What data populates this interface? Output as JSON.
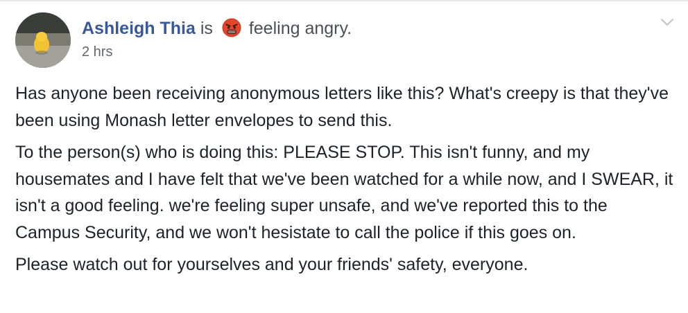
{
  "post": {
    "author_name": "Ashleigh Thia",
    "connector": "is",
    "feeling_icon": "angry-face-emoji",
    "feeling_text": "feeling angry.",
    "timestamp": "2 hrs",
    "menu_icon": "chevron-down-icon",
    "paragraphs": [
      "Has anyone been receiving anonymous letters like this? What's creepy is that they've been using Monash letter envelopes to send this.",
      "To the person(s) who is doing this: PLEASE STOP. This isn't funny, and my housemates and I have felt that we've been watched for a while now, and I SWEAR, it isn't a good feeling. we're feeling super unsafe, and we've reported this to the Campus Security, and we won't hesistate to call the police if this goes on.",
      "Please watch out for yourselves and your friends' safety, everyone."
    ]
  },
  "colors": {
    "author_link": "#385898",
    "secondary_text": "#616770",
    "body_text": "#1d2129",
    "emoji_red": "#e2452b"
  }
}
